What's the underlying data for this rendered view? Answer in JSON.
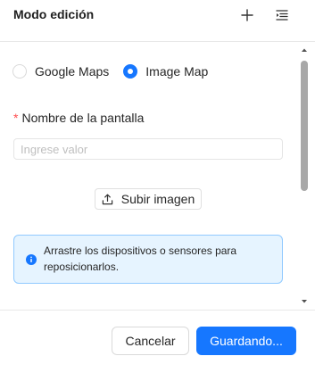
{
  "header": {
    "title": "Modo edición",
    "add_icon": "plus-icon",
    "menu_icon": "menu-unfold-icon"
  },
  "map_type": {
    "options": [
      {
        "label": "Google Maps",
        "selected": false
      },
      {
        "label": "Image Map",
        "selected": true
      }
    ]
  },
  "form": {
    "screen_name_label": "Nombre de la pantalla",
    "required_mark": "*",
    "screen_name_value": "",
    "screen_name_placeholder": "Ingrese valor",
    "upload_label": "Subir imagen",
    "upload_icon": "upload-icon"
  },
  "alert": {
    "icon": "info-circle-icon",
    "text": "Arrastre los dispositivos o sensores para reposicionarlos."
  },
  "footer": {
    "cancel_label": "Cancelar",
    "save_label": "Guardando..."
  },
  "colors": {
    "primary": "#1677ff",
    "alert_bg": "#e6f4ff",
    "alert_border": "#91caff",
    "required": "#ff4d4f"
  }
}
